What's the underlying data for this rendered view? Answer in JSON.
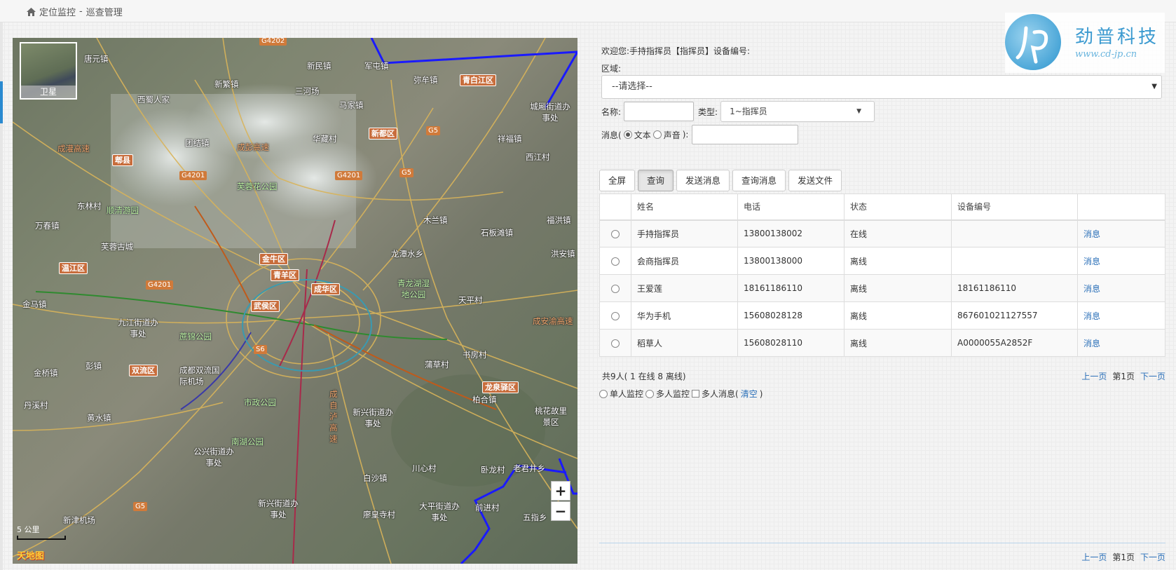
{
  "breadcrumb": {
    "part1": "定位监控",
    "sep": " - ",
    "part2": "巡查管理"
  },
  "map": {
    "layer_button": "卫星",
    "zoom_in": "+",
    "zoom_out": "−",
    "scale": "5 公里",
    "provider": "天地图",
    "labels": [
      "唐元镇",
      "新民镇",
      "军屯镇",
      "弥牟镇",
      "西蜀人家",
      "新繁镇",
      "三河场",
      "马家镇",
      "城厢街道办事处",
      "团结镇",
      "华藏村",
      "祥福镇",
      "西江村",
      "东林村",
      "万春镇",
      "木兰镇",
      "福洪镇",
      "石板滩镇",
      "芙蓉古城",
      "龙潭水乡",
      "洪安镇",
      "金马镇",
      "天平村",
      "九江街道办事处",
      "书房村",
      "金桥镇",
      "彭镇",
      "成都双流国际机场",
      "蒲草村",
      "丹溪村",
      "柏合镇",
      "黄水镇",
      "新兴街道办事处",
      "桃花故里景区",
      "公兴街道办事处",
      "川心村",
      "卧龙村",
      "老君井乡",
      "白沙镇",
      "新兴街道办事处",
      "廖皇寺村",
      "大平街道办事处",
      "前进村",
      "五指乡",
      "新津机场",
      "成安渝高速",
      "成自泸高速",
      "成灌高速",
      "成彭高速"
    ],
    "districts": [
      "青白江区",
      "新都区",
      "郫县",
      "金牛区",
      "青羊区",
      "成华区",
      "武侯区",
      "温江区",
      "双流区",
      "龙泉驿区"
    ],
    "roads": [
      "G4202",
      "G5",
      "G4201",
      "G4201",
      "G5",
      "G4201",
      "S6",
      "G5"
    ],
    "parks": [
      "芙蓉花公园",
      "顺清游园",
      "青龙湖湿地公园",
      "蔗锦公园",
      "市政公园",
      "南湖公园"
    ]
  },
  "panel": {
    "welcome": "欢迎您:手持指挥员【指挥员】设备编号:",
    "region_label": "区域:",
    "region_value": "--请选择--",
    "name_label": "名称:",
    "name_value": "",
    "type_label": "类型:",
    "type_value": "1~指挥员",
    "msg_label": "消息(",
    "msg_text": "文本",
    "msg_voice": "声音",
    "msg_close": "):",
    "msg_value": ""
  },
  "buttons": {
    "fullscreen": "全屏",
    "query": "查询",
    "send_msg": "发送消息",
    "query_msg": "查询消息",
    "send_file": "发送文件"
  },
  "table": {
    "headers": [
      "",
      "姓名",
      "电话",
      "状态",
      "设备编号",
      ""
    ],
    "rows": [
      {
        "name": "手持指挥员",
        "phone": "13800138002",
        "status": "在线",
        "device": "",
        "action": "消息"
      },
      {
        "name": "会商指挥员",
        "phone": "13800138000",
        "status": "离线",
        "device": "",
        "action": "消息"
      },
      {
        "name": "王爱莲",
        "phone": "18161186110",
        "status": "离线",
        "device": "18161186110",
        "action": "消息"
      },
      {
        "name": "华为手机",
        "phone": "15608028128",
        "status": "离线",
        "device": "867601021127557",
        "action": "消息"
      },
      {
        "name": "稻草人",
        "phone": "15608028110",
        "status": "离线",
        "device": "A0000055A2852F",
        "action": "消息"
      }
    ]
  },
  "summary": "共9人( 1 在线 8 离线)",
  "pager": {
    "prev": "上一页",
    "page": "第1页",
    "next": "下一页"
  },
  "modes": {
    "single": "单人监控",
    "multi": "多人监控",
    "multi_msg": "多人消息(",
    "clear": "清空",
    "close": ")"
  },
  "logo": {
    "name": "劲普科技",
    "url": "www.cd-jp.cn"
  }
}
